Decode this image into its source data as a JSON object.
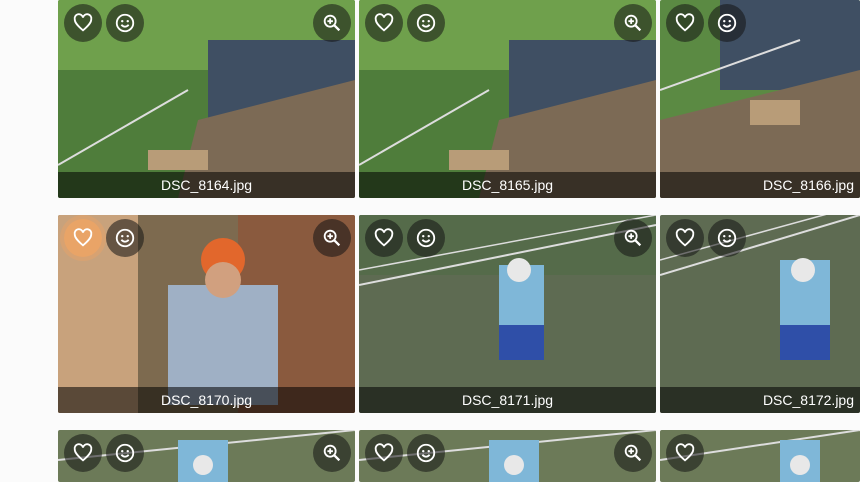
{
  "gallery": {
    "tiles": [
      {
        "filename": "DSC_8164.jpg",
        "scene": "group",
        "liked": false
      },
      {
        "filename": "DSC_8165.jpg",
        "scene": "group",
        "liked": false
      },
      {
        "filename": "DSC_8166.jpg",
        "scene": "group",
        "liked": false
      },
      {
        "filename": "DSC_8170.jpg",
        "scene": "closeup",
        "liked": true
      },
      {
        "filename": "DSC_8171.jpg",
        "scene": "zipline",
        "liked": false
      },
      {
        "filename": "DSC_8172.jpg",
        "scene": "zipline",
        "liked": false
      },
      {
        "filename": "",
        "scene": "zipline-partial",
        "liked": false
      },
      {
        "filename": "",
        "scene": "zipline-partial",
        "liked": false
      },
      {
        "filename": "",
        "scene": "zipline-partial",
        "liked": false
      }
    ]
  },
  "icons": {
    "like": "heart-outline-icon",
    "face": "smiley-face-icon",
    "zoom": "zoom-in-icon"
  },
  "colors": {
    "caption_bg": "#000000",
    "active_like": "#f4a460"
  }
}
